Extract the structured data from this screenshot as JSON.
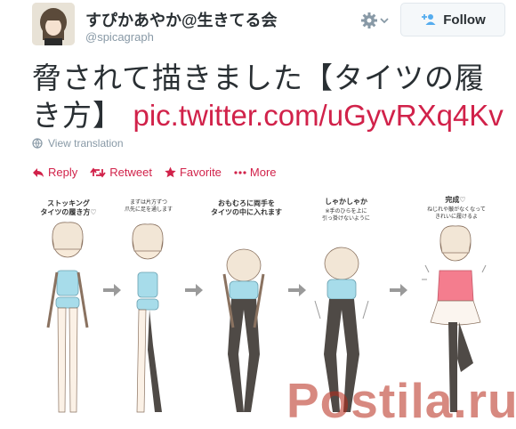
{
  "author": {
    "name": "すぴかあやか@生きてる会",
    "handle": "@spicagraph"
  },
  "follow_label": "Follow",
  "tweet": {
    "text": "脅されて描きました【タイツの履き方】 ",
    "link": "pic.twitter.com/uGyvRXq4Kv"
  },
  "view_translation": "View translation",
  "actions": {
    "reply": "Reply",
    "retweet": "Retweet",
    "favorite": "Favorite",
    "more": "More"
  },
  "colors": {
    "accent": "#d1224a",
    "secondary_text": "#8899a6"
  },
  "illustration": {
    "steps": [
      {
        "title": "ストッキング\nタイツの履き方♡",
        "note": ""
      },
      {
        "title": "",
        "note": "まずは片方ずつ\n爪先に足を通します"
      },
      {
        "title": "おもむろに両手を\nタイツの中に入れます",
        "note": ""
      },
      {
        "title": "しゃかしゃか",
        "note": "※手のひらを上に\n引っ掛けないように"
      },
      {
        "title": "完成♡",
        "note": "ねじれや皺がなくなって\nきれいに履けるよ"
      }
    ]
  },
  "watermark": "Postila.ru"
}
